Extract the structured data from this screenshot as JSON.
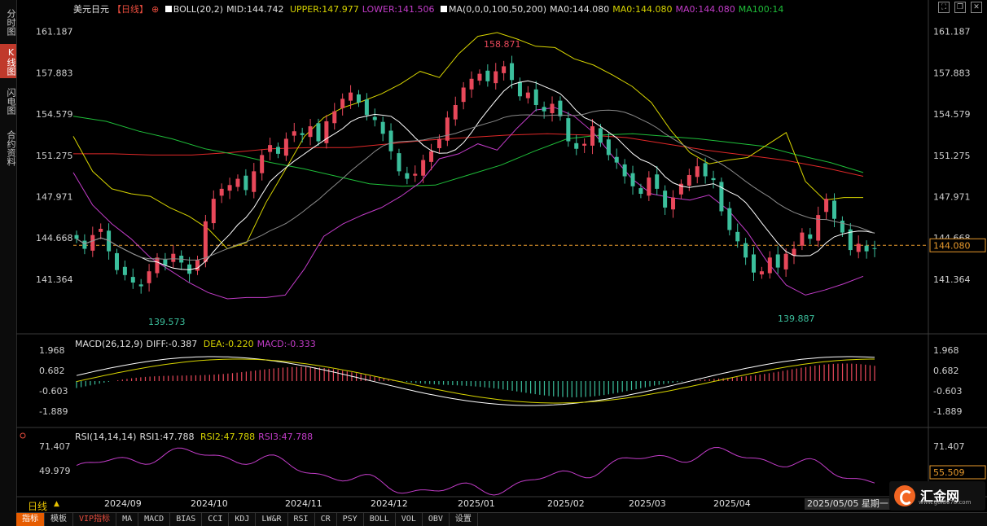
{
  "left_rail": {
    "tabs": [
      "分时图",
      "K线图",
      "闪电图",
      "合约资料"
    ],
    "active": 1
  },
  "header": {
    "symbol": "美元日元",
    "period": "【日线】",
    "boll": "BOLL(20,2)",
    "mid": "MID:144.742",
    "upper": "UPPER:147.977",
    "lower": "LOWER:141.506",
    "ma_params": "MA(0,0,0,100,50,200)",
    "ma0_a": "MA0:144.080",
    "ma0_b": "MA0:144.080",
    "ma0_c": "MA0:144.080",
    "ma100": "MA100:14"
  },
  "macd_header": {
    "name": "MACD(26,12,9)",
    "diff": "DIFF:-0.387",
    "dea": "DEA:-0.220",
    "macd": "MACD:-0.333"
  },
  "rsi_header": {
    "name": "RSI(14,14,14)",
    "rsi1": "RSI1:47.788",
    "rsi2": "RSI2:47.788",
    "rsi3": "RSI3:47.788"
  },
  "price_axis": {
    "ticks": [
      "161.187",
      "157.883",
      "154.579",
      "151.275",
      "147.971",
      "144.668",
      "141.364"
    ],
    "current": "144.080"
  },
  "macd_axis": {
    "ticks": [
      "1.968",
      "0.682",
      "-0.603",
      "-1.889"
    ]
  },
  "rsi_axis": {
    "ticks": [
      "71.407",
      "49.979"
    ],
    "current": "55.509"
  },
  "x_axis": {
    "labels": [
      "2024/09",
      "2024/10",
      "2024/11",
      "2024/12",
      "2025/01",
      "2025/02",
      "2025/03",
      "2025/04"
    ]
  },
  "annotations": {
    "high": "158.871",
    "low1": "139.573",
    "low2": "139.887"
  },
  "cursor_date": "2025/05/05 星期一",
  "period_label": "日线",
  "period_arrow": "▲",
  "bottom_tabs": [
    "指标",
    "模板",
    "VIP指标",
    "MA",
    "MACD",
    "BIAS",
    "CCI",
    "KDJ",
    "LW&R",
    "RSI",
    "CR",
    "PSY",
    "BOLL",
    "VOL",
    "OBV",
    "设置"
  ],
  "logo": {
    "text": "汇金网",
    "sub": "www.gold678.com"
  },
  "colors": {
    "up": "#e8485a",
    "down": "#3bbf9c",
    "boll_band": "#d7d400",
    "boll_lower": "#c23cc8",
    "mid": "#ffffff",
    "ma100": "#1fbf3a",
    "ma200": "#e02828",
    "ma50": "#8a8a8a",
    "macd_diff": "#ffffff",
    "macd_dea": "#d7d400"
  },
  "chart_data": {
    "type": "candlestick",
    "price_range": [
      138.3,
      162.4
    ],
    "candle_count": 175,
    "close_path": [
      144.6,
      143.8,
      144.9,
      145.4,
      143.6,
      142.1,
      141.7,
      141.1,
      140.8,
      142.0,
      143.1,
      142.5,
      143.4,
      142.7,
      141.8,
      142.9,
      146.0,
      147.8,
      148.6,
      148.9,
      149.4,
      148.5,
      150.0,
      151.3,
      152.1,
      151.4,
      152.6,
      153.2,
      152.9,
      153.6,
      152.4,
      154.0,
      154.8,
      155.8,
      156.3,
      155.5,
      154.5,
      154.1,
      153.0,
      151.6,
      150.0,
      149.4,
      149.8,
      150.9,
      151.6,
      152.6,
      154.3,
      155.3,
      156.7,
      157.4,
      157.8,
      157.2,
      158.0,
      158.4,
      157.3,
      156.0,
      156.3,
      155.3,
      154.8,
      155.4,
      154.4,
      152.4,
      151.8,
      152.2,
      153.6,
      152.3,
      151.3,
      150.7,
      149.6,
      148.8,
      148.2,
      149.5,
      148.6,
      147.1,
      147.9,
      149.0,
      149.7,
      150.4,
      149.6,
      149.3,
      146.8,
      145.3,
      144.4,
      143.1,
      141.9,
      142.0,
      143.1,
      142.3,
      143.4,
      143.8,
      145.1,
      144.6,
      146.5,
      147.8,
      146.2,
      145.1,
      143.7,
      144.2,
      143.6,
      143.8
    ],
    "boll_upper": [
      152.8,
      150.0,
      148.6,
      148.2,
      148.0,
      147.1,
      146.4,
      145.4,
      143.8,
      144.3,
      147.5,
      150.1,
      152.8,
      154.3,
      155.1,
      155.6,
      156.2,
      157.0,
      158.0,
      157.5,
      159.4,
      160.8,
      161.1,
      160.6,
      160.0,
      159.9,
      159.0,
      158.5,
      157.7,
      156.8,
      155.5,
      153.3,
      151.5,
      150.6,
      150.9,
      151.1,
      152.1,
      153.1,
      149.2,
      147.7,
      147.9,
      147.9
    ],
    "boll_lower": [
      149.9,
      147.3,
      145.8,
      144.6,
      143.1,
      142.1,
      141.1,
      140.3,
      139.8,
      139.9,
      139.9,
      140.1,
      142.2,
      144.8,
      145.8,
      146.5,
      147.1,
      148.0,
      149.1,
      151.0,
      151.4,
      152.2,
      151.7,
      153.4,
      154.9,
      155.1,
      154.4,
      153.1,
      151.2,
      149.4,
      148.2,
      147.9,
      147.7,
      148.1,
      146.9,
      145.1,
      142.8,
      140.9,
      140.1,
      140.5,
      141.0,
      141.6
    ],
    "ma200": [
      151.4,
      151.4,
      151.3,
      151.3,
      151.5,
      151.8,
      151.9,
      151.9,
      152.2,
      152.5,
      152.7,
      152.9,
      153.0,
      152.9,
      152.7,
      152.2,
      151.7,
      151.3,
      150.9,
      150.3,
      149.6
    ],
    "ma100": [
      154.4,
      154.0,
      153.2,
      152.6,
      151.8,
      151.3,
      150.7,
      150.2,
      149.6,
      149.0,
      148.8,
      148.9,
      149.7,
      150.5,
      151.6,
      152.6,
      152.9,
      153.0,
      152.8,
      152.6,
      152.3,
      152.0,
      151.3,
      150.7,
      149.9
    ]
  }
}
